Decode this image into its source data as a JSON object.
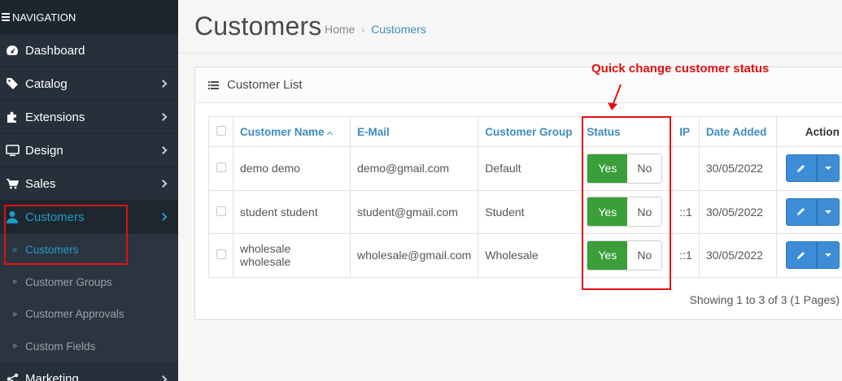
{
  "sidebar": {
    "header": "NAVIGATION",
    "items": [
      {
        "label": "Dashboard",
        "icon": "dashboard-icon",
        "chevron": false
      },
      {
        "label": "Catalog",
        "icon": "tag-icon",
        "chevron": true
      },
      {
        "label": "Extensions",
        "icon": "puzzle-icon",
        "chevron": true
      },
      {
        "label": "Design",
        "icon": "monitor-icon",
        "chevron": true
      },
      {
        "label": "Sales",
        "icon": "cart-icon",
        "chevron": true
      },
      {
        "label": "Customers",
        "icon": "user-icon",
        "chevron": true,
        "active": true
      }
    ],
    "sub_items": [
      {
        "label": "Customers",
        "active": true
      },
      {
        "label": "Customer Groups"
      },
      {
        "label": "Customer Approvals"
      },
      {
        "label": "Custom Fields"
      }
    ],
    "partial_item": {
      "label": "Marketing",
      "icon": "share-icon"
    }
  },
  "header": {
    "title": "Customers",
    "breadcrumb": [
      "Home",
      "Customers"
    ]
  },
  "panel": {
    "title": "Customer List",
    "columns": [
      "Customer Name",
      "E-Mail",
      "Customer Group",
      "Status",
      "IP",
      "Date Added",
      "Action"
    ],
    "rows": [
      {
        "name": "demo demo",
        "email": "demo@gmail.com",
        "group": "Default",
        "ip": "",
        "date": "30/05/2022"
      },
      {
        "name": "student student",
        "email": "student@gmail.com",
        "group": "Student",
        "ip": "::1",
        "date": "30/05/2022"
      },
      {
        "name": "wholesale wholesale",
        "email": "wholesale@gmail.com",
        "group": "Wholesale",
        "ip": "::1",
        "date": "30/05/2022"
      }
    ],
    "toggle": {
      "yes": "Yes",
      "no": "No"
    },
    "showing": "Showing 1 to 3 of 3 (1 Pages)"
  },
  "annotation": {
    "text": "Quick change customer status",
    "color": "#e01010"
  },
  "colors": {
    "sidebar_bg": "#26303a",
    "accent": "#229ac8",
    "link": "#3c8dbc",
    "yes_green": "#3a9f3a",
    "button_blue": "#3c8dd6"
  }
}
